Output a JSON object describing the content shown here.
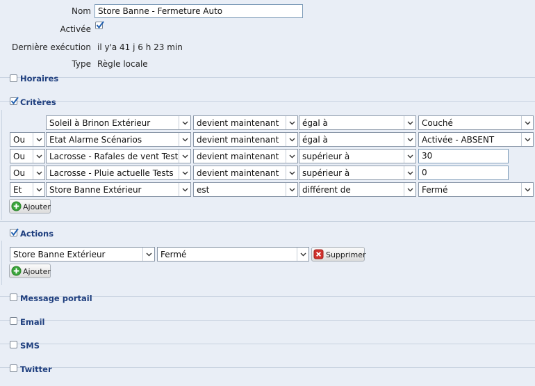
{
  "form": {
    "name_label": "Nom",
    "name_value": "Store Banne - Fermeture Auto",
    "active_label": "Activée",
    "active_checked": true,
    "last_exec_label": "Dernière exécution",
    "last_exec_value": "il y'a 41 j 6 h 23 min",
    "type_label": "Type",
    "type_value": "Règle locale"
  },
  "sections": {
    "horaires": "Horaires",
    "criteres": "Critères",
    "actions": "Actions",
    "message_portail": "Message portail",
    "email": "Email",
    "sms": "SMS",
    "twitter": "Twitter"
  },
  "criteria": [
    {
      "conj": "",
      "device": "Soleil à Brinon Extérieur",
      "event": "devient maintenant",
      "op": "égal à",
      "value": "Couché",
      "value_kind": "select"
    },
    {
      "conj": "Ou",
      "device": "Etat Alarme Scénarios",
      "event": "devient maintenant",
      "op": "égal à",
      "value": "Activée - ABSENT",
      "value_kind": "select"
    },
    {
      "conj": "Ou",
      "device": "Lacrosse - Rafales de vent Tests",
      "event": "devient maintenant",
      "op": "supérieur à",
      "value": "30",
      "value_kind": "input"
    },
    {
      "conj": "Ou",
      "device": "Lacrosse - Pluie actuelle Tests",
      "event": "devient maintenant",
      "op": "supérieur à",
      "value": "0",
      "value_kind": "input"
    },
    {
      "conj": "Et",
      "device": "Store Banne Extérieur",
      "event": "est",
      "op": "différent de",
      "value": "Fermé",
      "value_kind": "select"
    }
  ],
  "buttons": {
    "add": "Ajouter",
    "delete": "Supprimer"
  },
  "action": {
    "device": "Store Banne Extérieur",
    "state": "Fermé"
  },
  "colors": {
    "background": "#e9eef6",
    "section_title": "#1e3e7e",
    "add_icon": "#3aa53a",
    "delete_icon": "#d0312d"
  }
}
